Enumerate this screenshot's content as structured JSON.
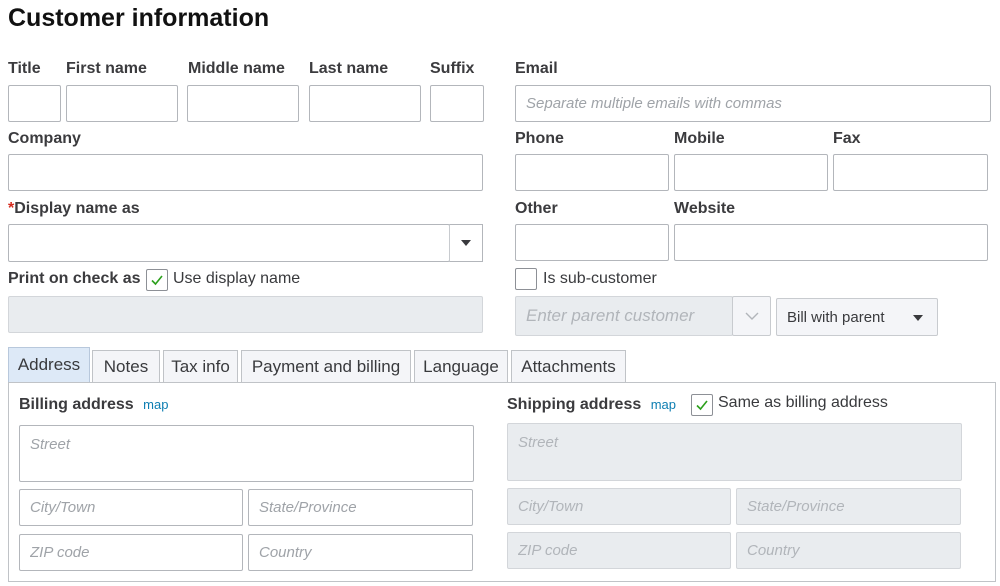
{
  "page": {
    "title": "Customer information"
  },
  "name_fields": {
    "title_label": "Title",
    "first_label": "First name",
    "middle_label": "Middle name",
    "last_label": "Last name",
    "suffix_label": "Suffix"
  },
  "email": {
    "label": "Email",
    "placeholder": "Separate multiple emails with commas"
  },
  "company": {
    "label": "Company"
  },
  "phones": {
    "phone_label": "Phone",
    "mobile_label": "Mobile",
    "fax_label": "Fax"
  },
  "display_name": {
    "required_mark": "*",
    "label": "Display name as"
  },
  "other": {
    "other_label": "Other",
    "website_label": "Website"
  },
  "print_on_check": {
    "label": "Print on check as",
    "use_display_name_label": "Use display name",
    "use_display_name_checked": true
  },
  "sub_customer": {
    "label": "Is sub-customer",
    "checked": false,
    "parent_placeholder": "Enter parent customer",
    "bill_with_value": "Bill with parent"
  },
  "tabs": [
    {
      "label": "Address",
      "active": true
    },
    {
      "label": "Notes",
      "active": false
    },
    {
      "label": "Tax info",
      "active": false
    },
    {
      "label": "Payment and billing",
      "active": false
    },
    {
      "label": "Language",
      "active": false
    },
    {
      "label": "Attachments",
      "active": false
    }
  ],
  "billing": {
    "label": "Billing address",
    "map_link": "map",
    "street_placeholder": "Street",
    "city_placeholder": "City/Town",
    "state_placeholder": "State/Province",
    "zip_placeholder": "ZIP code",
    "country_placeholder": "Country"
  },
  "shipping": {
    "label": "Shipping address",
    "map_link": "map",
    "same_as_billing_label": "Same as billing address",
    "same_as_billing_checked": true,
    "street_placeholder": "Street",
    "city_placeholder": "City/Town",
    "state_placeholder": "State/Province",
    "zip_placeholder": "ZIP code",
    "country_placeholder": "Country"
  },
  "colors": {
    "checkmark": "#2ca01c",
    "link": "#0d7eb2",
    "required": "#d52b1e",
    "active_tab": "#dde9f7"
  },
  "icons": {
    "checkbox_check": "checkmark-icon",
    "dropdown": "chevron-down-icon"
  }
}
